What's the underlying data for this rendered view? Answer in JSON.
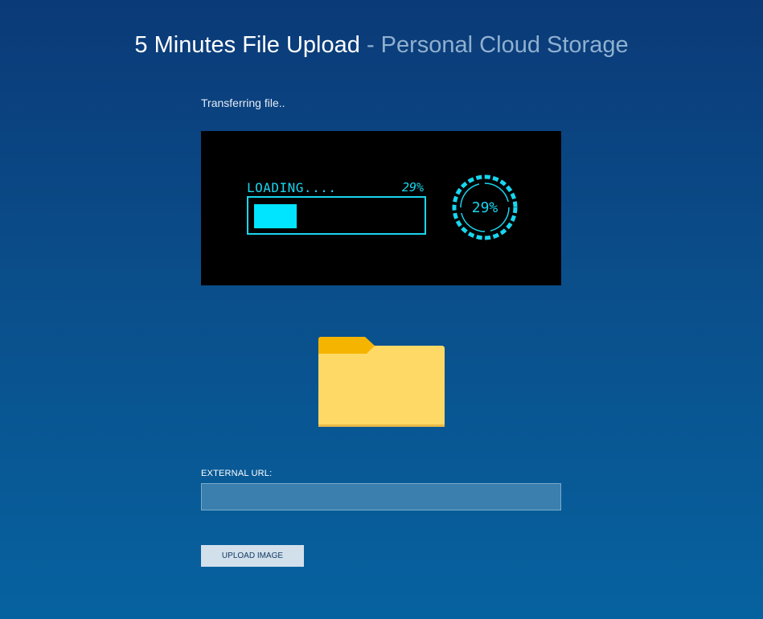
{
  "header": {
    "title": "5 Minutes File Upload",
    "separator": " - ",
    "subtitle": "Personal Cloud Storage"
  },
  "status_text": "Transferring file..",
  "loader": {
    "label": "LOADING....",
    "percent_text": "29%",
    "progress": 0.29,
    "accent_color": "#19d6ef",
    "fill_color": "#00e5ff"
  },
  "folder": {
    "icon": "folder-icon",
    "front_color": "#ffd966",
    "tab_color": "#f5b400"
  },
  "form": {
    "url_label": "EXTERNAL URL:",
    "url_value": "",
    "upload_label": "UPLOAD IMAGE"
  }
}
